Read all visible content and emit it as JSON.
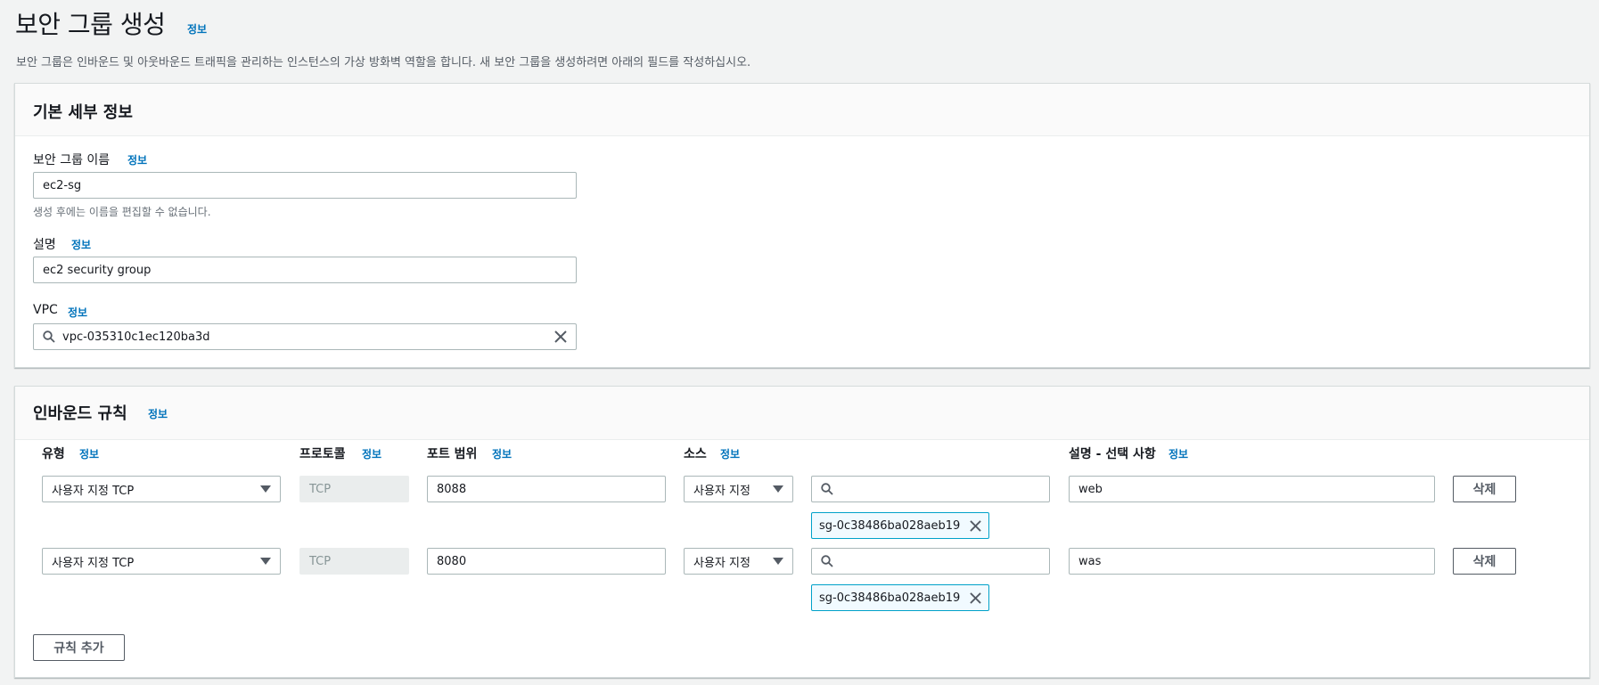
{
  "page": {
    "title": "보안 그룹 생성",
    "info": "정보",
    "description": "보안 그룹은 인바운드 및 아웃바운드 트래픽을 관리하는 인스턴스의 가상 방화벽 역할을 합니다. 새 보안 그룹을 생성하려면 아래의 필드를 작성하십시오."
  },
  "basic": {
    "title": "기본 세부 정보",
    "name_label": "보안 그룹 이름",
    "name_value": "ec2-sg",
    "name_hint": "생성 후에는 이름을 편집할 수 없습니다.",
    "desc_label": "설명",
    "desc_value": "ec2 security group",
    "vpc_label": "VPC",
    "vpc_value": "vpc-035310c1ec120ba3d"
  },
  "inbound": {
    "title": "인바운드 규칙",
    "columns": {
      "type": "유형",
      "protocol": "프로토콜",
      "port": "포트 범위",
      "source": "소스",
      "description": "설명 - 선택 사항"
    },
    "rules": [
      {
        "type": "사용자 지정 TCP",
        "protocol": "TCP",
        "port": "8088",
        "source": "사용자 지정",
        "search": "",
        "token": "sg-0c38486ba028aeb19",
        "description": "web",
        "delete": "삭제"
      },
      {
        "type": "사용자 지정 TCP",
        "protocol": "TCP",
        "port": "8080",
        "source": "사용자 지정",
        "search": "",
        "token": "sg-0c38486ba028aeb19",
        "description": "was",
        "delete": "삭제"
      }
    ],
    "add_rule": "규칙 추가"
  },
  "icons": {
    "search": "search-icon",
    "clear": "close-icon",
    "caret": "caret-down-icon",
    "remove_token": "close-icon"
  },
  "colors": {
    "link": "#0073bb",
    "token_border": "#00a1c9",
    "token_bg": "#f1faff"
  }
}
